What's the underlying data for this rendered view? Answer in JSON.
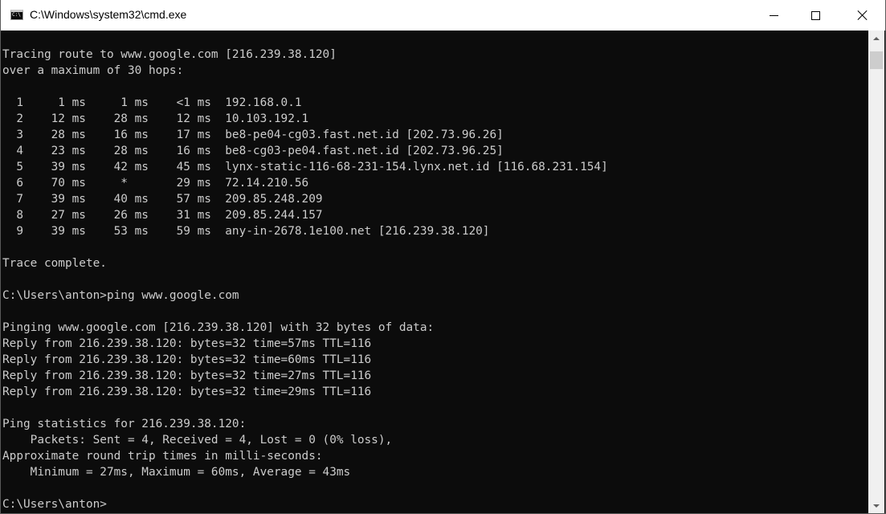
{
  "window": {
    "title": "C:\\Windows\\system32\\cmd.exe",
    "icon_text": "C:\\"
  },
  "console": {
    "lines": [
      "Tracing route to www.google.com [216.239.38.120]",
      "over a maximum of 30 hops:",
      "",
      "  1     1 ms     1 ms    <1 ms  192.168.0.1",
      "  2    12 ms    28 ms    12 ms  10.103.192.1",
      "  3    28 ms    16 ms    17 ms  be8-pe04-cg03.fast.net.id [202.73.96.26]",
      "  4    23 ms    28 ms    16 ms  be8-cg03-pe04.fast.net.id [202.73.96.25]",
      "  5    39 ms    42 ms    45 ms  lynx-static-116-68-231-154.lynx.net.id [116.68.231.154]",
      "  6    70 ms     *       29 ms  72.14.210.56",
      "  7    39 ms    40 ms    57 ms  209.85.248.209",
      "  8    27 ms    26 ms    31 ms  209.85.244.157",
      "  9    39 ms    53 ms    59 ms  any-in-2678.1e100.net [216.239.38.120]",
      "",
      "Trace complete.",
      "",
      "C:\\Users\\anton>ping www.google.com",
      "",
      "Pinging www.google.com [216.239.38.120] with 32 bytes of data:",
      "Reply from 216.239.38.120: bytes=32 time=57ms TTL=116",
      "Reply from 216.239.38.120: bytes=32 time=60ms TTL=116",
      "Reply from 216.239.38.120: bytes=32 time=27ms TTL=116",
      "Reply from 216.239.38.120: bytes=32 time=29ms TTL=116",
      "",
      "Ping statistics for 216.239.38.120:",
      "    Packets: Sent = 4, Received = 4, Lost = 0 (0% loss),",
      "Approximate round trip times in milli-seconds:",
      "    Minimum = 27ms, Maximum = 60ms, Average = 43ms",
      "",
      "C:\\Users\\anton>"
    ]
  },
  "colors": {
    "console_bg": "#0c0c0c",
    "console_fg": "#cccccc",
    "titlebar_bg": "#ffffff"
  }
}
